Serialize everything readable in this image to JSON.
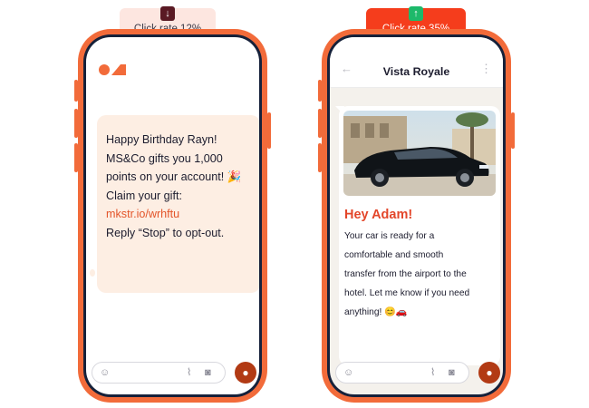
{
  "badges": {
    "left": {
      "label": "Click rate 12%",
      "icon": "arrow-down-icon",
      "color": "#5a1a24"
    },
    "right": {
      "label": "Click rate 35%",
      "icon": "arrow-up-icon",
      "color": "#1db96a"
    }
  },
  "sms_phone": {
    "logo": "brand-logo",
    "message": {
      "line1": "Happy Birthday Rayn!",
      "line2": "MS&Co gifts you 1,000",
      "line3": "points on your account! 🎉",
      "line4": "Claim your gift:",
      "link": "mkstr.io/wrhftu",
      "line5": "Reply “Stop” to opt-out."
    }
  },
  "wa_phone": {
    "contact_name": "Vista Royale",
    "message": {
      "heading": "Hey Adam!",
      "body_lines": [
        "Your car is ready for a",
        "comfortable and smooth",
        "transfer from the airport to the",
        "hotel. Let me know if you need",
        "anything! 😊🚗"
      ]
    }
  },
  "colors": {
    "accent": "#f26b3a",
    "frame": "#16213a",
    "mic": "#b23a14"
  }
}
